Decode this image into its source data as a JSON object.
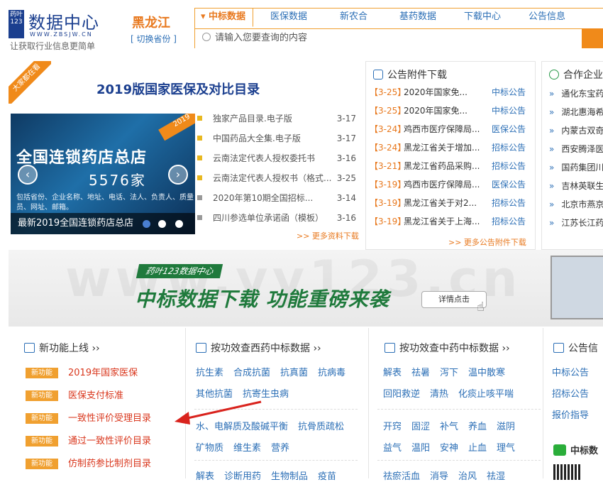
{
  "header": {
    "logo_mark": "药叶123",
    "logo_title": "数据中心",
    "logo_url": "WWW.ZBSJW.CN",
    "logo_slogan": "让获取行业信息更简单",
    "province": "黑龙江",
    "switch_label": "[ 切换省份 ]",
    "tabs": [
      "▾ 中标数据",
      "医保数据",
      "新农合",
      "基药数据",
      "下载中心",
      "公告信息"
    ],
    "search_placeholder": "请输入您要查询的内容"
  },
  "feature": {
    "title": "2019版国家医保及对比目录",
    "badge": "大家都在看",
    "banner": {
      "tag": "2019",
      "headline": "全国连锁药店总店",
      "count": "5576家",
      "small": "包括省份、企业名称、地址、电话、法人、负责人、质量员、网址、邮箱。",
      "caption": "最新2019全国连锁药店总店"
    },
    "docs": [
      {
        "title": "独家产品目录.电子版",
        "date": "3-17",
        "color": "#e8b820"
      },
      {
        "title": "中国药品大全集.电子版",
        "date": "3-17",
        "color": "#e8b820"
      },
      {
        "title": "云南法定代表人授权委托书",
        "date": "3-16",
        "color": "#e8b820"
      },
      {
        "title": "云南法定代表人授权书（格式...",
        "date": "3-25",
        "color": "#e8b820"
      },
      {
        "title": "2020年第10期全国招标...",
        "date": "3-14",
        "color": "#999999"
      },
      {
        "title": "四川参选单位承诺函（模板）",
        "date": "3-16",
        "color": "#999999"
      }
    ],
    "more": ">> 更多资料下载"
  },
  "notice": {
    "title": "公告附件下载",
    "rows": [
      {
        "date": "【3-25】",
        "title": "2020年国家免...",
        "cat": "中标公告"
      },
      {
        "date": "【3-25】",
        "title": "2020年国家免...",
        "cat": "中标公告"
      },
      {
        "date": "【3-24】",
        "title": "鸡西市医疗保障局...",
        "cat": "医保公告"
      },
      {
        "date": "【3-24】",
        "title": "黑龙江省关于增加...",
        "cat": "招标公告"
      },
      {
        "date": "【3-21】",
        "title": "黑龙江省药品采购...",
        "cat": "招标公告"
      },
      {
        "date": "【3-19】",
        "title": "鸡西市医疗保障局...",
        "cat": "医保公告"
      },
      {
        "date": "【3-19】",
        "title": "黑龙江省关于对2...",
        "cat": "招标公告"
      },
      {
        "date": "【3-19】",
        "title": "黑龙江省关于上海...",
        "cat": "招标公告"
      }
    ],
    "more": ">> 更多公告附件下载"
  },
  "partner": {
    "title": "合作企业",
    "items": [
      "通化东宝药",
      "湖北惠海希",
      "内蒙古双奇",
      "西安腾泽医",
      "国药集团川",
      "吉林英联生",
      "北京市燕京",
      "江苏长江药"
    ]
  },
  "ad": {
    "watermark": "www.yy123.cn",
    "brand": "药叶123数据中心",
    "headline": "中标数据下载 功能重磅来袭",
    "button": "详情点击"
  },
  "newfeatures": {
    "title": "新功能上线 ››",
    "badge": "新功能",
    "items": [
      "2019年国家医保",
      "医保支付标准",
      "一致性评价受理目录",
      "通过一致性评价目录",
      "仿制药参比制剂目录"
    ]
  },
  "western": {
    "title": "按功效查西药中标数据 ››",
    "rows": [
      [
        "抗生素",
        "合成抗菌",
        "抗真菌",
        "抗病毒"
      ],
      [
        "其他抗菌",
        "抗寄生虫病"
      ],
      [
        "水、电解质及酸碱平衡",
        "抗骨质疏松"
      ],
      [
        "矿物质",
        "维生素",
        "营养"
      ],
      [
        "解表",
        "诊断用药",
        "生物制品",
        "疫苗"
      ]
    ]
  },
  "chinese": {
    "title": "按功效查中药中标数据 ››",
    "rows": [
      [
        "解表",
        "祛暑",
        "泻下",
        "温中散寒"
      ],
      [
        "回阳救逆",
        "清热",
        "化痰止咳平喘"
      ],
      [
        "开窍",
        "固涩",
        "补气",
        "养血",
        "滋阴"
      ],
      [
        "益气",
        "温阳",
        "安神",
        "止血",
        "理气"
      ],
      [
        "祛瘀活血",
        "消导",
        "治风",
        "祛湿"
      ]
    ]
  },
  "announce": {
    "title": "公告信",
    "items": [
      "中标公告",
      "招标公告",
      "报价指导"
    ],
    "wechat": "中标数"
  }
}
